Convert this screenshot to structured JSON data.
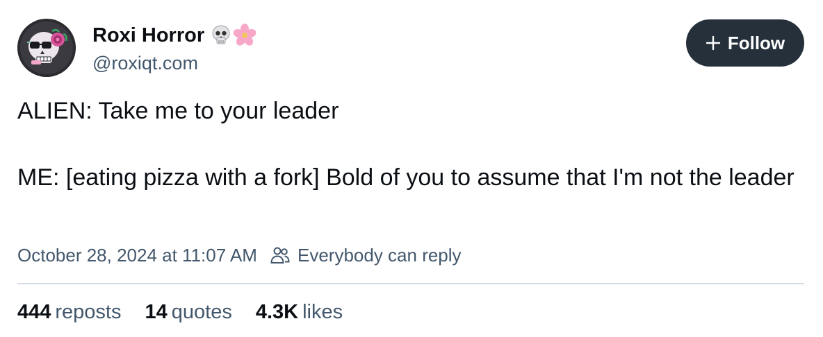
{
  "author": {
    "display_name": "Roxi Horror",
    "name_emojis": [
      "skull-icon",
      "cherry-blossom-icon"
    ],
    "handle": "@roxiqt.com",
    "avatar": "skull-avatar"
  },
  "follow_button": {
    "label": "Follow",
    "icon": "plus-icon"
  },
  "post": {
    "paragraphs": [
      "ALIEN: Take me to your leader",
      "ME: [eating pizza with a fork] Bold of you to assume that I'm not the leader"
    ]
  },
  "meta": {
    "timestamp": "October 28, 2024 at 11:07 AM",
    "reply_setting": "Everybody can reply",
    "reply_icon": "people-icon"
  },
  "stats": {
    "reposts": {
      "count": "444",
      "label": "reposts"
    },
    "quotes": {
      "count": "14",
      "label": "quotes"
    },
    "likes": {
      "count": "4.3K",
      "label": "likes"
    }
  },
  "colors": {
    "text_primary": "#0b0f14",
    "text_secondary": "#42576c",
    "button_bg": "#25303b",
    "divider": "#d4dbe2"
  }
}
